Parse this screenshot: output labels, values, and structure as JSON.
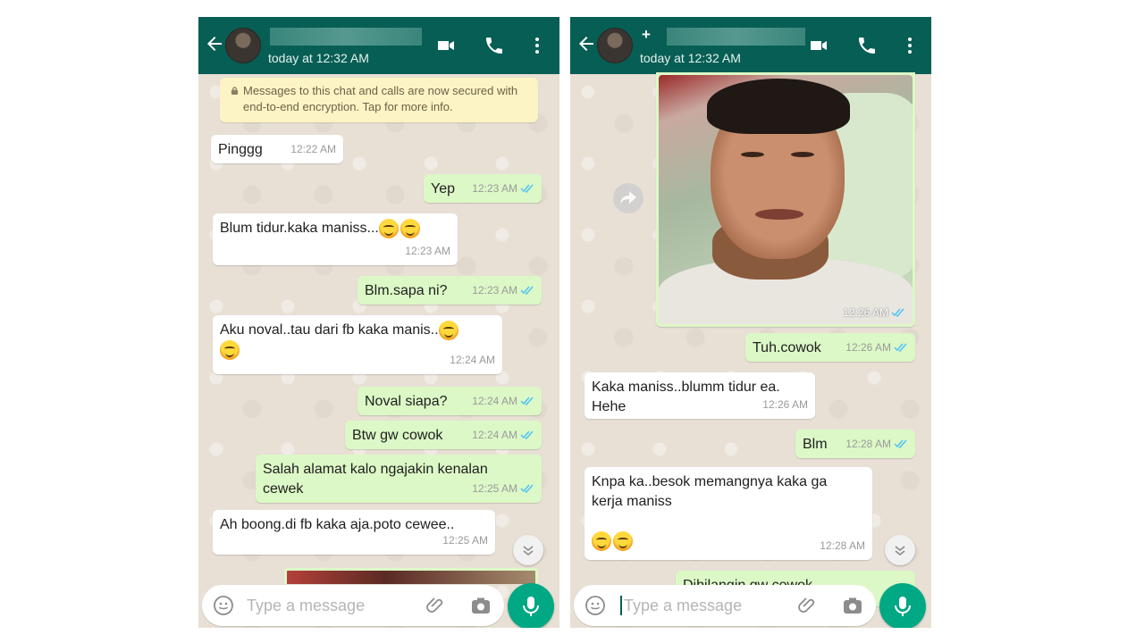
{
  "left": {
    "header": {
      "status": "today at 12:32 AM"
    },
    "encryption_notice": "Messages to this chat and calls are now secured with end-to-end encryption. Tap for more info.",
    "messages": [
      {
        "dir": "in",
        "text": "Pinggg",
        "time": "12:22 AM"
      },
      {
        "dir": "out",
        "text": "Yep",
        "time": "12:23 AM"
      },
      {
        "dir": "in",
        "text": "Blum tidur.kaka maniss...",
        "time": "12:23 AM",
        "emoji_count": 2
      },
      {
        "dir": "out",
        "text": "Blm.sapa ni?",
        "time": "12:23 AM"
      },
      {
        "dir": "in",
        "text": "Aku noval..tau dari fb kaka manis..",
        "time": "12:24 AM",
        "emoji_count": 2
      },
      {
        "dir": "out",
        "text": "Noval siapa?",
        "time": "12:24 AM"
      },
      {
        "dir": "out",
        "text": "Btw gw cowok",
        "time": "12:24 AM"
      },
      {
        "dir": "out",
        "text": "Salah alamat kalo ngajakin kenalan cewek",
        "time": "12:25 AM"
      },
      {
        "dir": "in",
        "text": "Ah boong.di fb kaka aja.poto cewee..",
        "time": "12:25 AM"
      }
    ],
    "composer": {
      "placeholder": "Type a message"
    }
  },
  "right": {
    "header": {
      "name_visible": "+",
      "status": "today at 12:32 AM"
    },
    "photo_message": {
      "time": "12:26 AM"
    },
    "messages": [
      {
        "dir": "out",
        "text": "Tuh.cowok",
        "time": "12:26 AM"
      },
      {
        "dir": "in",
        "text": "Kaka maniss..blumm tidur ea. Hehe",
        "time": "12:26 AM"
      },
      {
        "dir": "out",
        "text": "Blm",
        "time": "12:28 AM"
      },
      {
        "dir": "in",
        "text": "Knpa ka..besok memangnya kaka ga kerja maniss",
        "time": "12:28 AM",
        "emoji_count": 2
      },
      {
        "dir": "out",
        "text": "Dibilangin gw cowok",
        "time": ""
      }
    ],
    "composer": {
      "placeholder": "Type a message"
    }
  },
  "icons": [
    "back-arrow-icon",
    "video-call-icon",
    "phone-call-icon",
    "more-vert-icon",
    "lock-icon",
    "double-check-icon",
    "chevron-down-icon",
    "emoji-icon",
    "attach-icon",
    "camera-icon",
    "mic-icon",
    "forward-icon"
  ],
  "colors": {
    "header": "#075e54",
    "outgoing_bubble": "#dcf8c6",
    "incoming_bubble": "#ffffff",
    "encryption_banner": "#fdf4c5",
    "read_ticks": "#4fc3f7",
    "mic_button": "#00a884"
  }
}
